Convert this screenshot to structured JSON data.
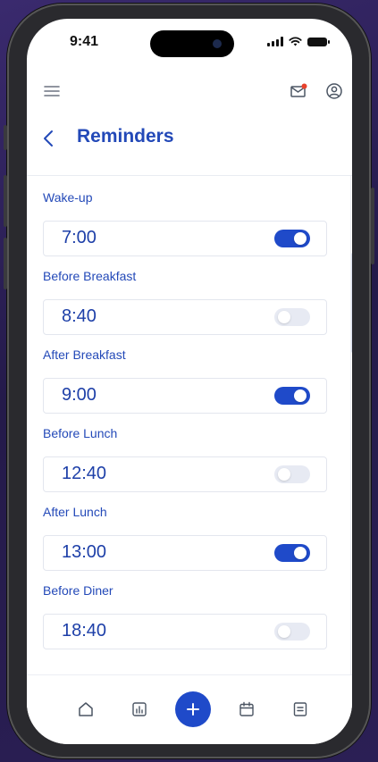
{
  "status_bar": {
    "time": "9:41"
  },
  "header": {
    "title": "Reminders"
  },
  "reminders": [
    {
      "label": "Wake-up",
      "time": "7:00",
      "enabled": true
    },
    {
      "label": "Before Breakfast",
      "time": "8:40",
      "enabled": false
    },
    {
      "label": "After Breakfast",
      "time": "9:00",
      "enabled": true
    },
    {
      "label": "Before Lunch",
      "time": "12:40",
      "enabled": false
    },
    {
      "label": "After Lunch",
      "time": "13:00",
      "enabled": true
    },
    {
      "label": "Before Diner",
      "time": "18:40",
      "enabled": false
    }
  ],
  "icons": {
    "menu": "menu-icon",
    "mail": "mail-icon",
    "profile": "profile-icon",
    "back": "chevron-left-icon",
    "nav": [
      "home-icon",
      "chart-icon",
      "plus-icon",
      "calendar-icon",
      "notes-icon"
    ]
  },
  "colors": {
    "accent": "#1f4ac9",
    "title": "#2349b8",
    "notification_dot": "#e8412c",
    "toggle_off": "#e7eaf3"
  }
}
